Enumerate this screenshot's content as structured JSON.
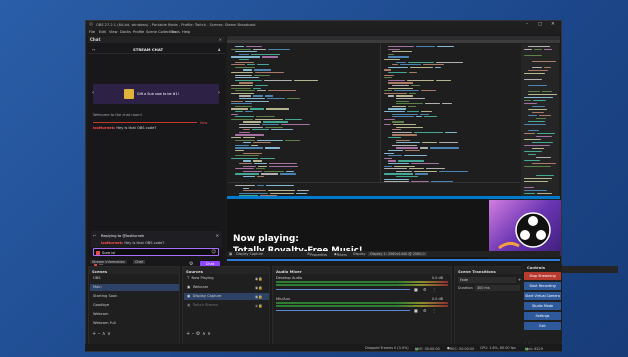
{
  "window": {
    "title": "OBS 27.2.1 (64-bit, windows) - Portable Mode - Profile: Twitch - Scenes: Steam Broadcast"
  },
  "menu": [
    "File",
    "Edit",
    "View",
    "Docks",
    "Profile",
    "Scene Collection",
    "Tools",
    "Help"
  ],
  "chat": {
    "dock_title": "Chat",
    "header": "STREAM CHAT",
    "gift_text": "Gift a Sub now to be #1!",
    "welcome": "Welcome to the chat room!",
    "new_label": "New",
    "message_user": "lostturnek",
    "message_text": "Hey is that OBS code?",
    "reply_title": "Replying to @lostturnek",
    "reply_user": "lostturnek",
    "reply_text": "Hey is that OBS code?",
    "input_value": "Sure is!",
    "chat_button": "Chat"
  },
  "preview": {
    "now_playing": "Now playing:",
    "track": "Totally Royalty-Free Music!"
  },
  "strip": {
    "display_capture": "Display Capture",
    "properties": "Properties",
    "filters": "Filters",
    "display": "Display",
    "display_value": "Display 1: 2560x1440 @ 2560,0"
  },
  "scenes": {
    "tabs": [
      "Stream Information",
      "Chat"
    ],
    "title": "Scenes",
    "items": [
      "OBS",
      "Main",
      "Starting Soon",
      "Goodbye",
      "Webcam",
      "Webcam Full"
    ]
  },
  "sources": {
    "title": "Sources",
    "items": [
      "Now Playing",
      "Webcam",
      "Display Capture",
      "Twitch Stream"
    ]
  },
  "mixer": {
    "title": "Audio Mixer",
    "channels": [
      {
        "name": "Desktop Audio",
        "db": "0.0 dB"
      },
      {
        "name": "Mic/Aux",
        "db": "0.0 dB"
      }
    ]
  },
  "transitions": {
    "title": "Scene Transitions",
    "type": "Fade",
    "duration_label": "Duration",
    "duration_value": "300 ms"
  },
  "controls": {
    "title": "Controls",
    "buttons": [
      "Stop Streaming",
      "Start Recording",
      "Start Virtual Camera",
      "Studio Mode",
      "Settings",
      "Exit"
    ]
  },
  "status": {
    "dropped": "Dropped Frames 0 (0.0%)",
    "live": "LIVE: 00:00:00",
    "rec": "REC: 00:00:00",
    "cpu": "CPU: 1.6%, 60.00 fps",
    "kbps": "kb/s: 6229"
  },
  "colors": {
    "accent": "#9147ff",
    "live_red": "#c0392b",
    "obs_blue": "#2e5a9c"
  }
}
